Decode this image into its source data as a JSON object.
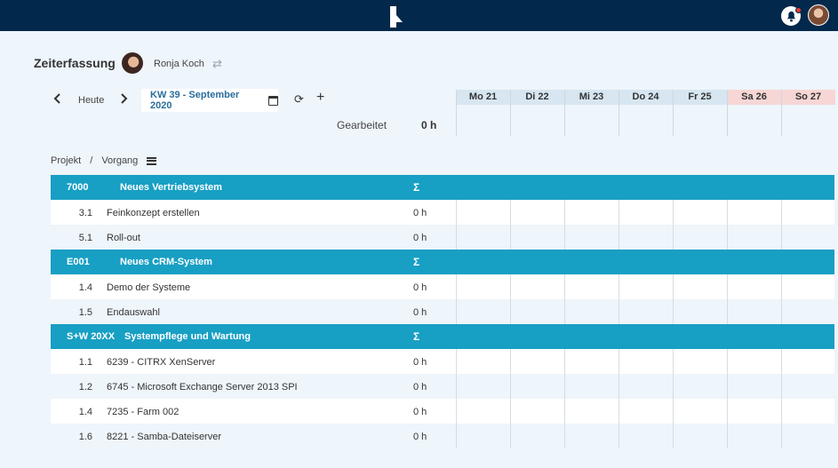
{
  "page": {
    "title": "Zeiterfassung",
    "user_name": "Ronja Koch"
  },
  "toolbar": {
    "today_label": "Heute",
    "week_label": "KW 39 - September 2020",
    "worked_label": "Gearbeitet",
    "worked_value": "0 h"
  },
  "days": [
    {
      "label": "Mo 21",
      "weekend": false
    },
    {
      "label": "Di 22",
      "weekend": false
    },
    {
      "label": "Mi 23",
      "weekend": false
    },
    {
      "label": "Do 24",
      "weekend": false
    },
    {
      "label": "Fr 25",
      "weekend": false
    },
    {
      "label": "Sa 26",
      "weekend": true
    },
    {
      "label": "So 27",
      "weekend": true
    }
  ],
  "breadcrumb": {
    "project": "Projekt",
    "separator": "/",
    "task": "Vorgang"
  },
  "projects": [
    {
      "code": "7000",
      "name": "Neues Vertriebsystem",
      "sum": "Σ",
      "tasks": [
        {
          "num": "3.1",
          "name": "Feinkonzept erstellen",
          "hours": "0 h"
        },
        {
          "num": "5.1",
          "name": "Roll-out",
          "hours": "0 h"
        }
      ]
    },
    {
      "code": "E001",
      "name": "Neues CRM-System",
      "sum": "Σ",
      "tasks": [
        {
          "num": "1.4",
          "name": "Demo der Systeme",
          "hours": "0 h"
        },
        {
          "num": "1.5",
          "name": "Endauswahl",
          "hours": "0 h"
        }
      ]
    },
    {
      "code": "S+W 20XX",
      "name": "Systempflege und Wartung",
      "sum": "Σ",
      "tasks": [
        {
          "num": "1.1",
          "name": "6239 - CITRX XenServer",
          "hours": "0 h"
        },
        {
          "num": "1.2",
          "name": "6745 - Microsoft Exchange Server 2013 SPI",
          "hours": "0 h"
        },
        {
          "num": "1.4",
          "name": "7235 - Farm 002",
          "hours": "0 h"
        },
        {
          "num": "1.6",
          "name": "8221 - Samba-Dateiserver",
          "hours": "0 h"
        }
      ]
    }
  ],
  "icons": {
    "logo": "app-logo-icon",
    "bell": "bell-icon",
    "swap": "swap-icon",
    "calendar": "calendar-icon",
    "refresh": "refresh-icon",
    "add": "plus-icon",
    "list": "list-icon"
  },
  "colors": {
    "topbar": "#02294b",
    "project_header": "#189fc4",
    "week_text": "#2a6d9c",
    "weekday_header": "#d7e6f1",
    "weekend_header": "#f7d6d6",
    "notification_dot": "#e53935"
  }
}
